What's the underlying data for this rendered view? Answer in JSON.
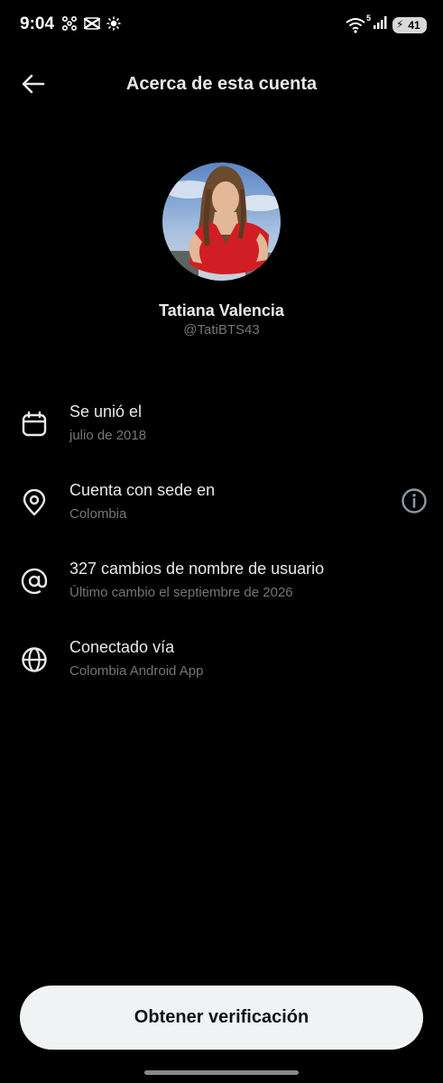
{
  "status_bar": {
    "time": "9:04",
    "left_icons": [
      "pinwheel-icon",
      "capcut-icon",
      "brightness-icon"
    ],
    "wifi_badge": "5",
    "battery_level": "41"
  },
  "header": {
    "title": "Acerca de esta cuenta",
    "back_icon": "arrow-left-icon"
  },
  "profile": {
    "name": "Tatiana Valencia",
    "handle": "@TatiBTS43"
  },
  "info_rows": [
    {
      "icon": "calendar-icon",
      "title": "Se unió el",
      "subtitle": "julio de 2018"
    },
    {
      "icon": "location-pin-icon",
      "title": "Cuenta con sede en",
      "subtitle": "Colombia",
      "action_icon": "info-icon"
    },
    {
      "icon": "at-sign-icon",
      "title": "327 cambios de nombre de usuario",
      "subtitle": "Último cambio el septiembre de 2026"
    },
    {
      "icon": "globe-icon",
      "title": "Conectado vía",
      "subtitle": "Colombia Android App"
    }
  ],
  "cta": {
    "label": "Obtener verificación"
  },
  "colors": {
    "background": "#000000",
    "primary_text": "#e7e9ea",
    "secondary_text": "#71767b",
    "button_bg": "#eff3f4",
    "button_text": "#0f1419"
  }
}
